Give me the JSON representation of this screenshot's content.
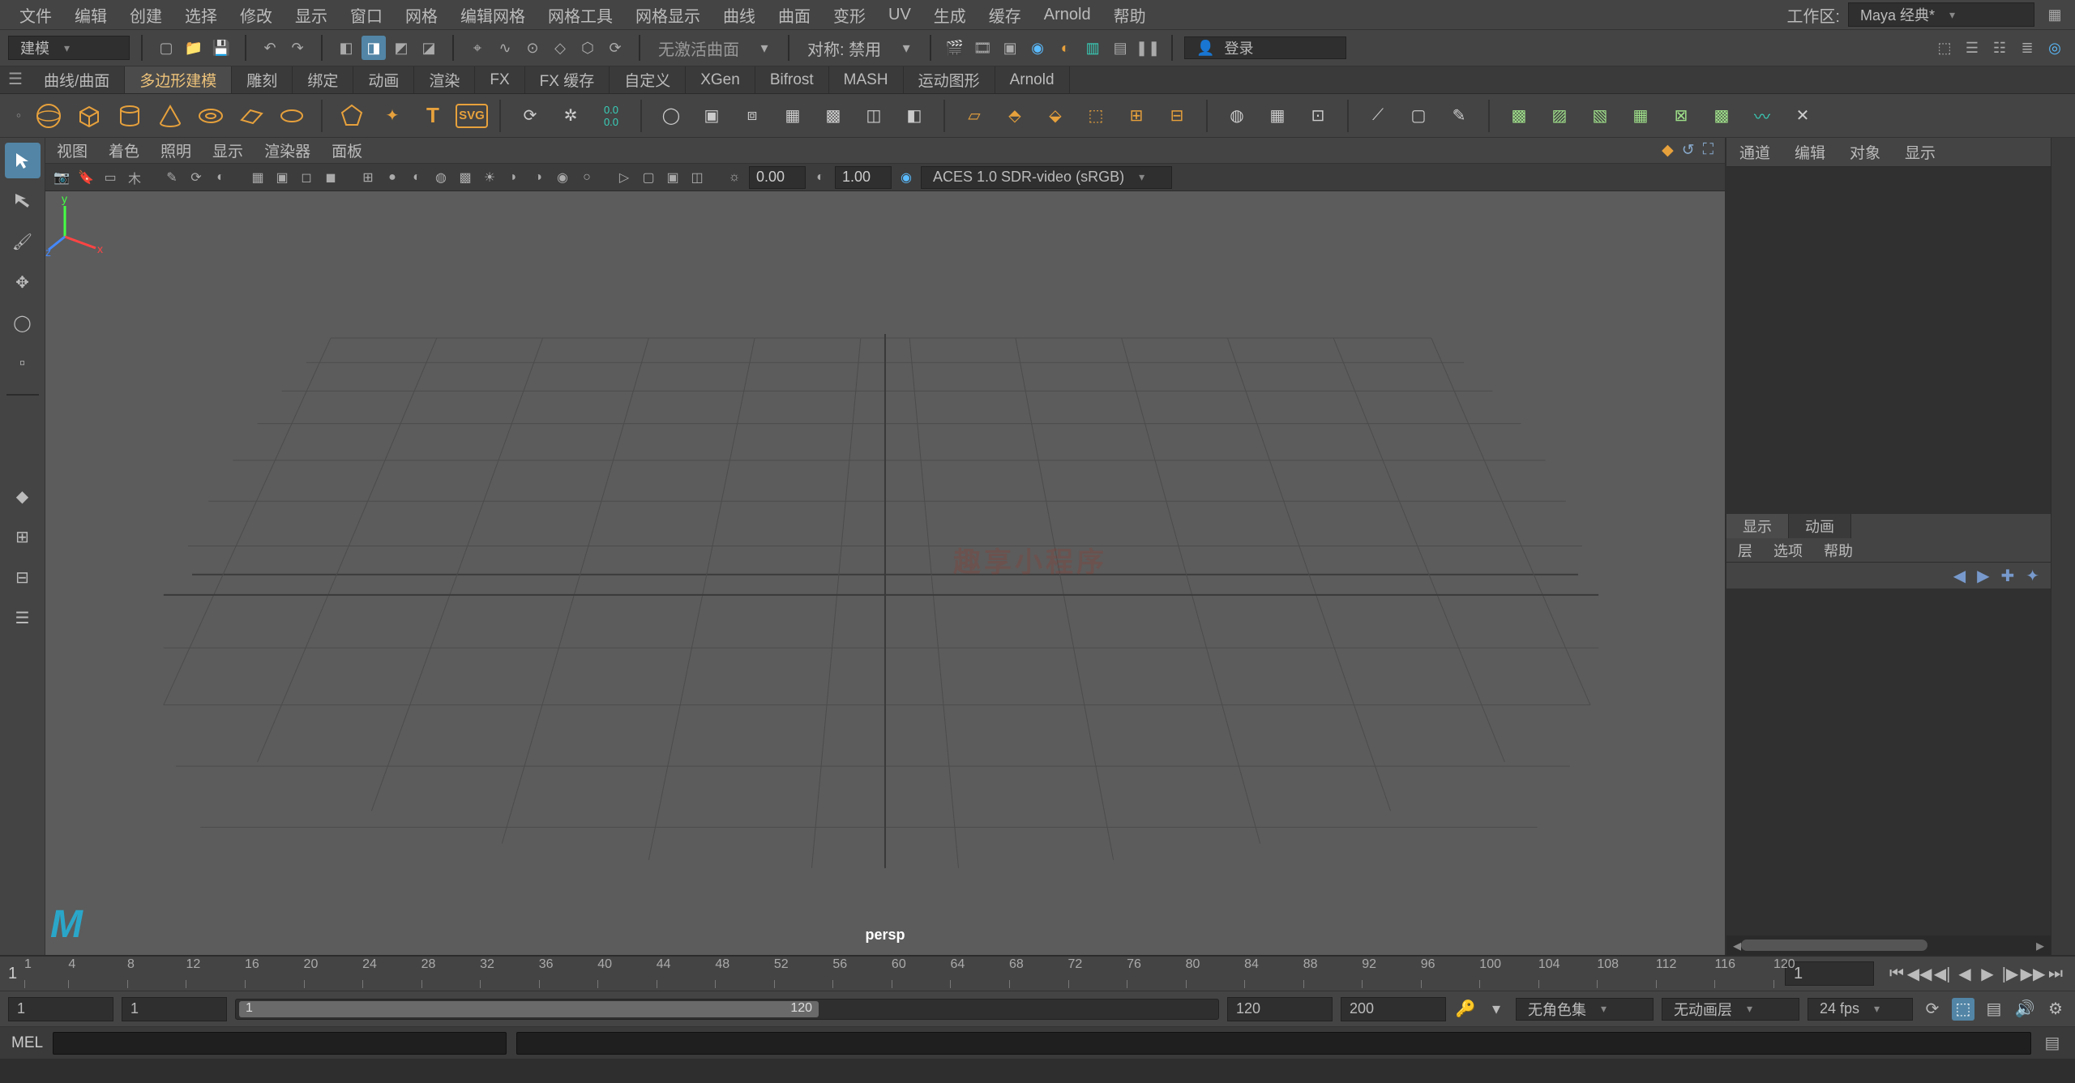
{
  "menubar": {
    "items": [
      "文件",
      "编辑",
      "创建",
      "选择",
      "修改",
      "显示",
      "窗口",
      "网格",
      "编辑网格",
      "网格工具",
      "网格显示",
      "曲线",
      "曲面",
      "变形",
      "UV",
      "生成",
      "缓存",
      "Arnold",
      "帮助"
    ],
    "workspace_label": "工作区:",
    "workspace_value": "Maya 经典*"
  },
  "statusline": {
    "module": "建模",
    "no_surface_label": "无激活曲面",
    "symmetry_label": "对称: 禁用",
    "login_label": "登录"
  },
  "shelf": {
    "tabs": [
      "曲线/曲面",
      "多边形建模",
      "雕刻",
      "绑定",
      "动画",
      "渲染",
      "FX",
      "FX 缓存",
      "自定义",
      "XGen",
      "Bifrost",
      "MASH",
      "运动图形",
      "Arnold"
    ],
    "active_tab_index": 1
  },
  "panel": {
    "menu": [
      "视图",
      "着色",
      "照明",
      "显示",
      "渲染器",
      "面板"
    ],
    "gamma": "1.00",
    "exposure": "0.00",
    "color_transform": "ACES 1.0 SDR-video (sRGB)",
    "camera_label": "persp"
  },
  "channelbox": {
    "tabs": [
      "通道",
      "编辑",
      "对象",
      "显示"
    ],
    "layer_tabs": [
      "显示",
      "动画"
    ],
    "layer_menu": [
      "层",
      "选项",
      "帮助"
    ],
    "active_layer_tab": 0
  },
  "timeline": {
    "start_marker": "1",
    "ticks": [
      1,
      4,
      8,
      12,
      16,
      20,
      24,
      28,
      32,
      36,
      40,
      44,
      48,
      52,
      56,
      60,
      64,
      68,
      72,
      76,
      80,
      84,
      88,
      92,
      96,
      100,
      104,
      108,
      112,
      116,
      120
    ],
    "current_frame": "1",
    "range_start_a": "1",
    "range_start_b": "1",
    "range_slider_start_label": "1",
    "range_slider_end_label": "120",
    "range_end_a": "120",
    "range_end_b": "200",
    "charset_label": "无角色集",
    "animlayer_label": "无动画层",
    "fps_label": "24 fps"
  },
  "cmd": {
    "lang": "MEL"
  },
  "watermark": "趣享小程序",
  "colors": {
    "amber": "#e7a13c",
    "accent": "#5285a6"
  }
}
